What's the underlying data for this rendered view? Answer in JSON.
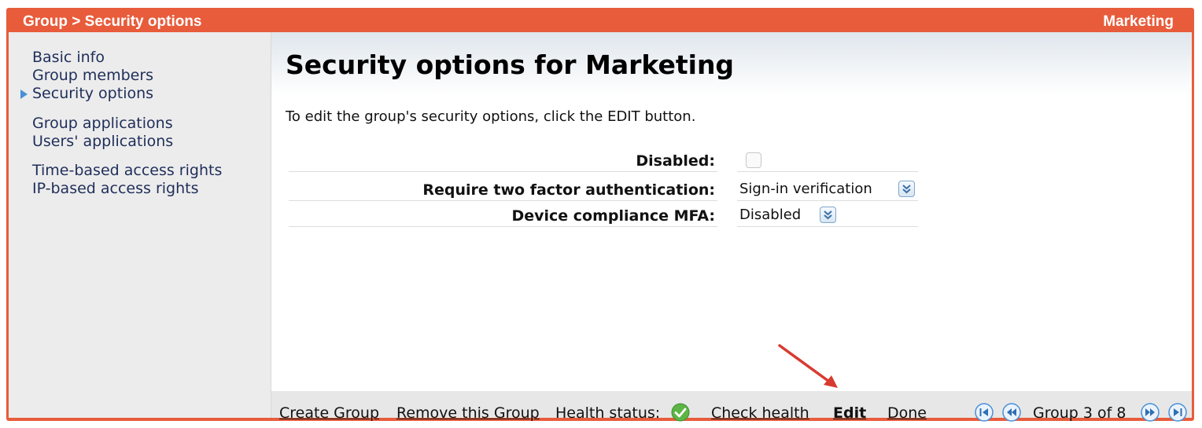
{
  "titlebar": {
    "breadcrumb": "Group > Security options",
    "group_name": "Marketing"
  },
  "sidebar": {
    "groups": [
      {
        "items": [
          {
            "label": "Basic info",
            "active": false
          },
          {
            "label": "Group members",
            "active": false
          },
          {
            "label": "Security options",
            "active": true
          }
        ]
      },
      {
        "items": [
          {
            "label": "Group applications",
            "active": false
          },
          {
            "label": "Users' applications",
            "active": false
          }
        ]
      },
      {
        "items": [
          {
            "label": "Time-based access rights",
            "active": false
          },
          {
            "label": "IP-based access rights",
            "active": false
          }
        ]
      }
    ]
  },
  "main": {
    "title": "Security options for Marketing",
    "instructions": "To edit the group's security options, click the EDIT button.",
    "fields": {
      "disabled": {
        "label": "Disabled:",
        "checked": false
      },
      "two_factor": {
        "label": "Require two factor authentication:",
        "value": "Sign-in verification"
      },
      "device_mfa": {
        "label": "Device compliance MFA:",
        "value": "Disabled"
      }
    }
  },
  "bottombar": {
    "create_group": "Create Group",
    "remove_group": "Remove this Group",
    "health_label": "Health status:",
    "health_status": "ok",
    "check_health": "Check health",
    "edit": "Edit",
    "done": "Done",
    "pager_text": "Group 3 of 8"
  },
  "colors": {
    "frame": "#e85c3b",
    "nav_text": "#1f2e5a",
    "pager_blue": "#4a8fd6",
    "annotation_arrow": "#d93a2f",
    "health_green": "#5cb545"
  },
  "icons": {
    "active_nav_marker": "triangle-right-icon",
    "dropdown": "double-chevron-down-icon",
    "health": "check-circle-icon",
    "pager_first": "skip-first-icon",
    "pager_prev": "rewind-icon",
    "pager_next": "fast-forward-icon",
    "pager_last": "skip-last-icon"
  }
}
